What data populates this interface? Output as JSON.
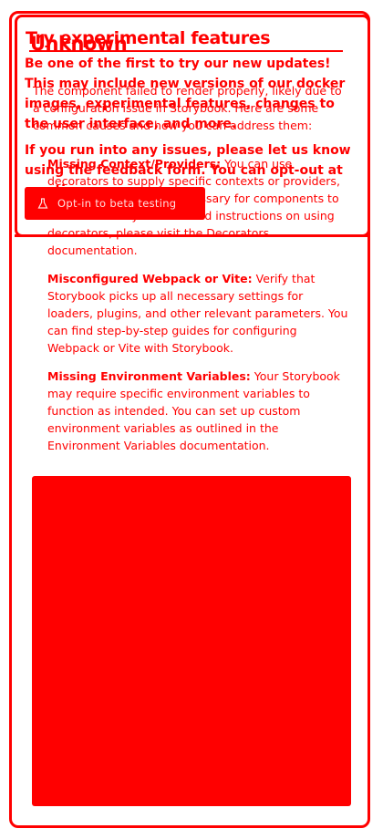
{
  "storybook_error": {
    "title": "Unknown",
    "intro": "The component failed to render properly, likely due to a configuration issue in Storybook. Here are some common causes and how you can address them:",
    "causes": [
      {
        "name": "Missing Context/Providers:",
        "text": " You can use decorators to supply specific contexts or providers, which are sometimes necessary for components to render correctly. For detailed instructions on using decorators, please visit the Decorators documentation."
      },
      {
        "name": "Misconfigured Webpack or Vite:",
        "text": " Verify that Storybook picks up all necessary settings for loaders, plugins, and other relevant parameters. You can find step-by-step guides for configuring Webpack or Vite with Storybook."
      },
      {
        "name": "Missing Environment Variables:",
        "text": " Your Storybook may require specific environment variables to function as intended. You can set up custom environment variables as outlined in the Environment Variables documentation."
      }
    ]
  },
  "banner": {
    "title": "Try experimental features",
    "paragraph1": "Be one of the first to try our new updates! This may include new versions of our docker images, experimental features, changes to the user interface, and more.",
    "paragraph2": "If you run into any issues, please let us know using the feedback form. You can opt-out at any time.",
    "button_label": "Opt-in to beta testing",
    "button_icon": "flask-icon"
  },
  "colors": {
    "accent": "#ff0000",
    "background": "#ffffff"
  }
}
